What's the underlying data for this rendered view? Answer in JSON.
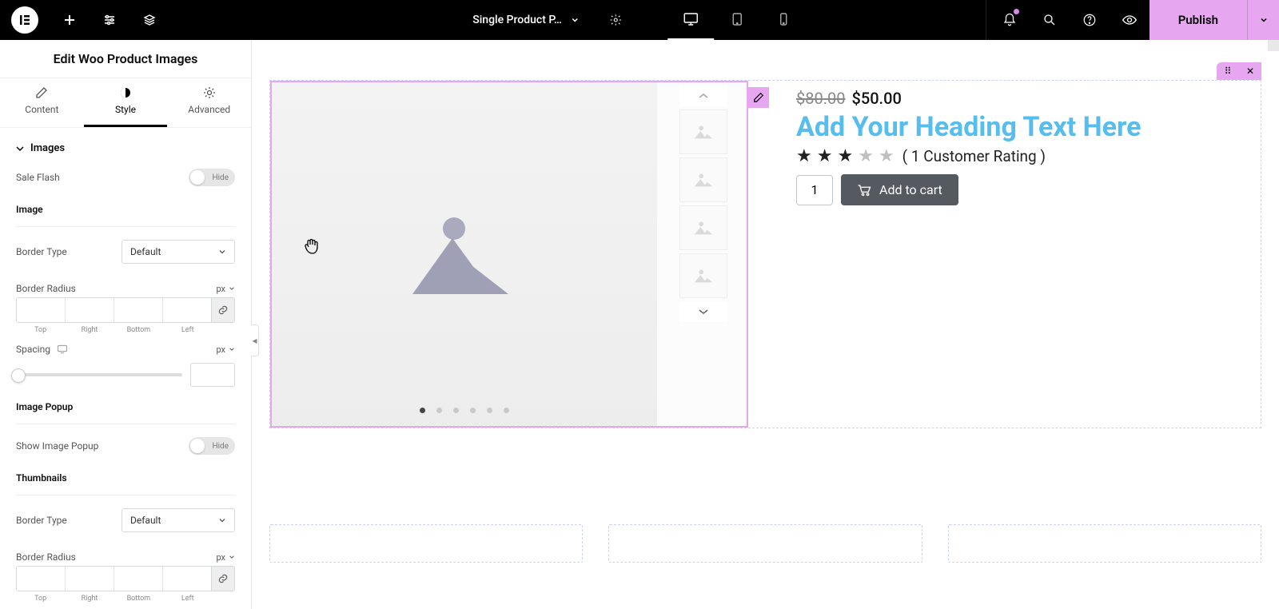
{
  "topbar": {
    "doc_title": "Single Product P…",
    "publish": "Publish"
  },
  "panel": {
    "title": "Edit Woo Product Images",
    "tabs": {
      "content": "Content",
      "style": "Style",
      "advanced": "Advanced"
    },
    "section_images": "Images",
    "sale_flash": {
      "label": "Sale Flash",
      "state": "Hide"
    },
    "image_hdr": "Image",
    "border_type": {
      "label": "Border Type",
      "value": "Default"
    },
    "border_radius_label": "Border Radius",
    "unit_px": "px",
    "sides": {
      "top": "Top",
      "right": "Right",
      "bottom": "Bottom",
      "left": "Left"
    },
    "spacing_label": "Spacing",
    "popup_hdr": "Image Popup",
    "show_popup": {
      "label": "Show Image Popup",
      "state": "Hide"
    },
    "thumbs_hdr": "Thumbnails",
    "thumb_border_type": {
      "label": "Border Type",
      "value": "Default"
    },
    "thumb_border_radius_label": "Border Radius"
  },
  "product": {
    "price_old": "$80.00",
    "price_new": "$50.00",
    "heading": "Add Your Heading Text Here",
    "rating_text": "( 1 Customer Rating )",
    "qty": "1",
    "add_to_cart": "Add to cart"
  },
  "colors": {
    "accent": "#e6a6f0",
    "heading": "#56bdef"
  }
}
